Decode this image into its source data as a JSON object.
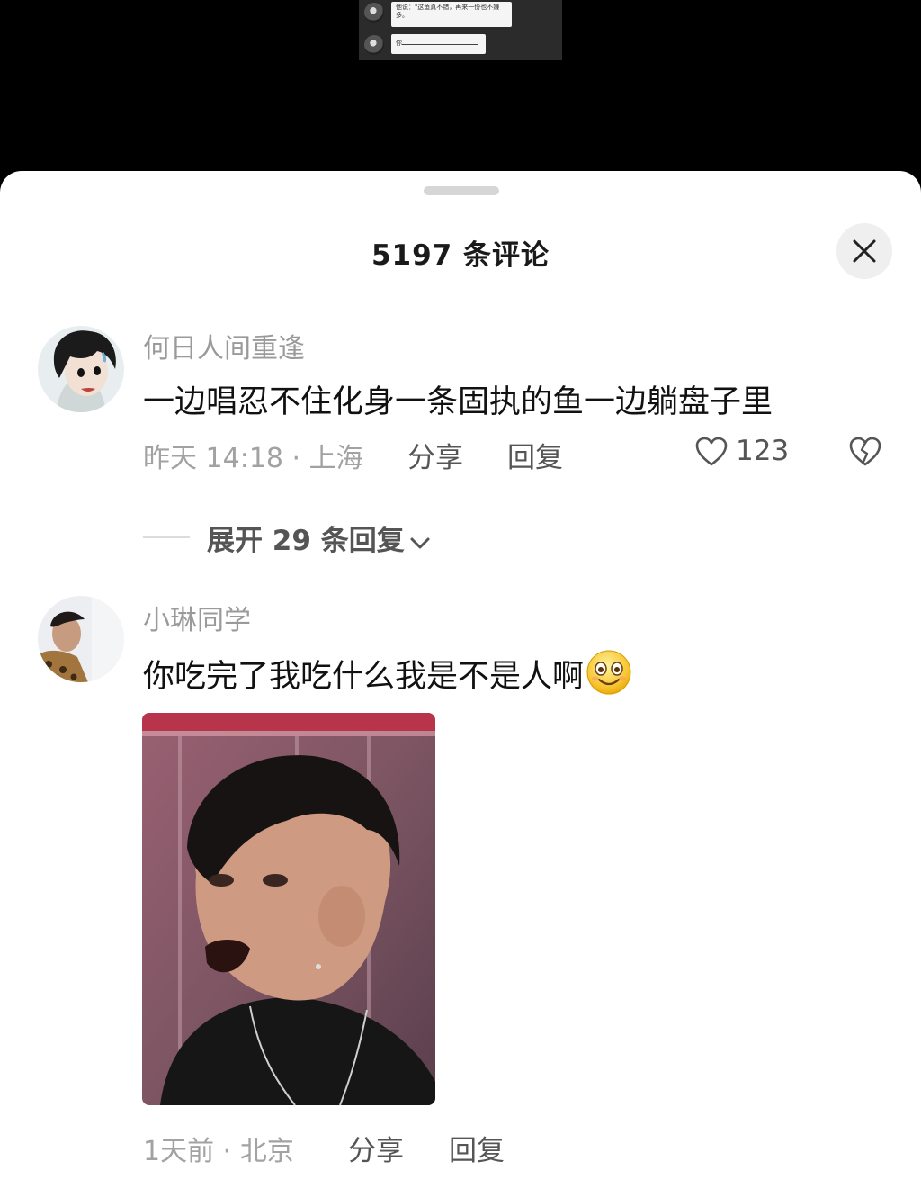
{
  "video": {
    "chat_line_1": "他说：\"这鱼真不错，再来一份也不嫌多。",
    "chat_line_2": "你"
  },
  "sheet": {
    "title": "5197 条评论",
    "close_icon": "close-icon"
  },
  "comments": [
    {
      "username": "何日人间重逢",
      "text": "一边唱忍不住化身一条固执的鱼一边躺盘子里",
      "time_location": "昨天 14:18 · 上海",
      "share": "分享",
      "reply": "回复",
      "like_count": "123",
      "expand_replies": "展开 29 条回复"
    },
    {
      "username": "小琳同学",
      "text": "你吃完了我吃什么我是不是人啊",
      "emoji": "smiling-face-emoji",
      "time_location": "1天前 · 北京",
      "share": "分享",
      "reply": "回复"
    }
  ],
  "colors": {
    "sheet_background": "#ffffff",
    "username": "#9a9a9a",
    "comment_text": "#111111",
    "secondary_text": "#555555"
  }
}
